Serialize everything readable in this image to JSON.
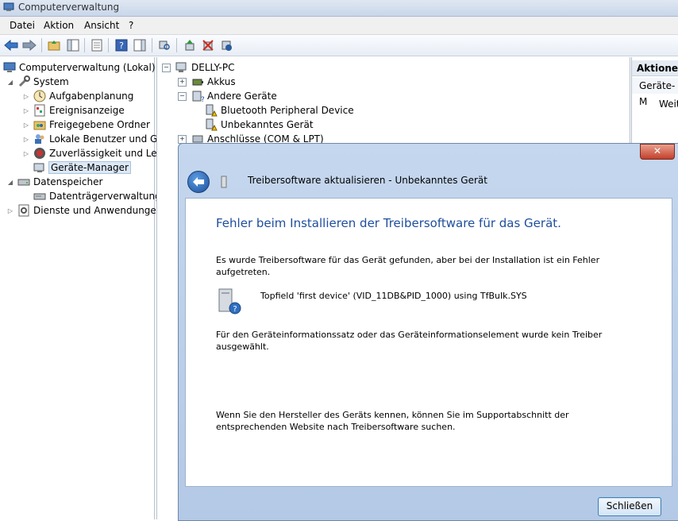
{
  "window": {
    "title": "Computerverwaltung"
  },
  "menu": {
    "items": [
      "Datei",
      "Aktion",
      "Ansicht",
      "?"
    ]
  },
  "left_tree": {
    "root": "Computerverwaltung (Lokal)",
    "system": "System",
    "aufgaben": "Aufgabenplanung",
    "ereignis": "Ereignisanzeige",
    "freigegeben": "Freigegebene Ordner",
    "lokale": "Lokale Benutzer und Gru",
    "zuverl": "Zuverlässigkeit und Leis",
    "geraete": "Geräte-Manager",
    "datenspeicher": "Datenspeicher",
    "datentraeger": "Datenträgerverwaltung",
    "dienste": "Dienste und Anwendungen"
  },
  "device_tree": {
    "pc": "DELLY-PC",
    "akkus": "Akkus",
    "andere": "Andere Geräte",
    "bluetooth": "Bluetooth Peripheral Device",
    "unbekannt": "Unbekanntes Gerät",
    "anschluesse": "Anschlüsse (COM & LPT)"
  },
  "actions_pane": {
    "header": "Aktionen",
    "sub": "Geräte-M",
    "item": "Weit"
  },
  "dialog": {
    "title": "Treibersoftware aktualisieren - Unbekanntes Gerät",
    "close": "✕",
    "heading": "Fehler beim Installieren der Treibersoftware für das Gerät.",
    "para1_line1": "Es wurde Treibersoftware für das Gerät gefunden, aber bei der Installation ist ein Fehler",
    "para1_line2": "aufgetreten.",
    "device_line": "Topfield 'first device' (VID_11DB&PID_1000) using TfBulk.SYS",
    "para2_line1": "Für den Geräteinformationssatz oder das Geräteinformationselement wurde kein Treiber",
    "para2_line2": "ausgewählt.",
    "para3_line1": "Wenn Sie den Hersteller des Geräts kennen, können Sie im Supportabschnitt der",
    "para3_line2": "entsprechenden Website nach Treibersoftware suchen.",
    "close_button": "Schließen"
  }
}
